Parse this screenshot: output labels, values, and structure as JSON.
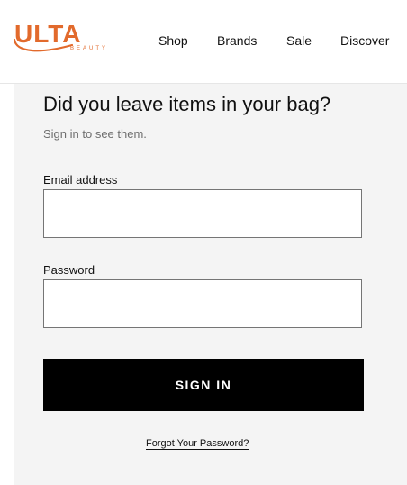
{
  "brand": {
    "name": "ULTA",
    "sub": "BEAUTY",
    "color": "#e26a2c"
  },
  "nav": {
    "items": [
      "Shop",
      "Brands",
      "Sale",
      "Discover"
    ]
  },
  "signin_form": {
    "headline": "Did you leave items in your bag?",
    "subtext": "Sign in to see them.",
    "email_label": "Email address",
    "email_value": "",
    "password_label": "Password",
    "password_value": "",
    "submit_label": "SIGN IN",
    "forgot_link": "Forgot Your Password?"
  }
}
